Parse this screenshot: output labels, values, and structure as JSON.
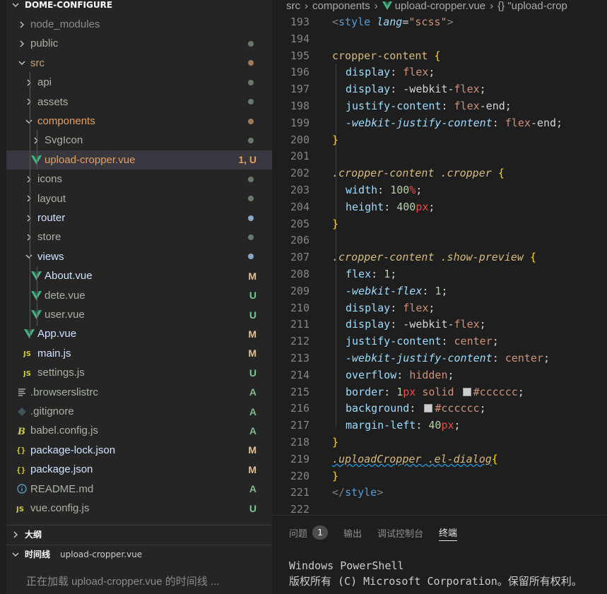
{
  "explorer": {
    "title": "DOME-CONFIGURE",
    "items": [
      {
        "label": "node_modules",
        "color": "#8c8c8c",
        "dec": "",
        "dot": ""
      },
      {
        "label": "public",
        "color": "#aab2a3",
        "dec": "",
        "dot": "#6a7a6a"
      },
      {
        "label": "src",
        "color": "#c5a27d",
        "dec": "",
        "dot": "#a07a5a"
      },
      {
        "label": "api",
        "color": "#aab2a3",
        "dec": "",
        "dot": "#6a7a6a"
      },
      {
        "label": "assets",
        "color": "#aab2a3",
        "dec": "",
        "dot": "#6a7a6a"
      },
      {
        "label": "components",
        "color": "#e2a062",
        "dec": "",
        "dot": "#a07a5a"
      },
      {
        "label": "SvgIcon",
        "color": "#aab2a3",
        "dec": "",
        "dot": "#6a7a6a"
      },
      {
        "label": "upload-cropper.vue",
        "color": "#e2a062",
        "dec": "1, U",
        "dot": ""
      },
      {
        "label": "icons",
        "color": "#aab2a3",
        "dec": "",
        "dot": "#6a7a6a"
      },
      {
        "label": "layout",
        "color": "#aab2a3",
        "dec": "",
        "dot": "#6a7a6a"
      },
      {
        "label": "router",
        "color": "#cfe3ff",
        "dec": "",
        "dot": "#88a7c7"
      },
      {
        "label": "store",
        "color": "#aab2a3",
        "dec": "",
        "dot": "#6a7a6a"
      },
      {
        "label": "views",
        "color": "#cfe3ff",
        "dec": "",
        "dot": "#88a7c7"
      },
      {
        "label": "About.vue",
        "color": "#cfe3ff",
        "dec": "M",
        "dot": ""
      },
      {
        "label": "dete.vue",
        "color": "#aab2a3",
        "dec": "U",
        "dot": ""
      },
      {
        "label": "user.vue",
        "color": "#aab2a3",
        "dec": "U",
        "dot": ""
      },
      {
        "label": "App.vue",
        "color": "#cfe3ff",
        "dec": "M",
        "dot": ""
      },
      {
        "label": "main.js",
        "color": "#cfe3ff",
        "dec": "M",
        "dot": ""
      },
      {
        "label": "settings.js",
        "color": "#aab2a3",
        "dec": "U",
        "dot": ""
      },
      {
        "label": ".browserslistrc",
        "color": "#aab2a3",
        "dec": "A",
        "dot": ""
      },
      {
        "label": ".gitignore",
        "color": "#aab2a3",
        "dec": "A",
        "dot": ""
      },
      {
        "label": "babel.config.js",
        "color": "#aab2a3",
        "dec": "A",
        "dot": ""
      },
      {
        "label": "package-lock.json",
        "color": "#cfe3ff",
        "dec": "M",
        "dot": ""
      },
      {
        "label": "package.json",
        "color": "#cfe3ff",
        "dec": "M",
        "dot": ""
      },
      {
        "label": "README.md",
        "color": "#aab2a3",
        "dec": "A",
        "dot": ""
      },
      {
        "label": "vue.config.js",
        "color": "#aab2a3",
        "dec": "U",
        "dot": ""
      }
    ],
    "outline_title": "大纲",
    "timeline_title": "时间线",
    "timeline_file": "upload-cropper.vue",
    "timeline_status": "正在加载 upload-cropper.vue 的时间线 ..."
  },
  "breadcrumb": {
    "parts": [
      "src",
      "components",
      "upload-cropper.vue",
      "{} \"upload-crop"
    ]
  },
  "editor": {
    "lines": [
      {
        "n": "193",
        "t": "<style lang=\"scss\">"
      },
      {
        "n": "194",
        "t": ""
      },
      {
        "n": "195",
        "t": "cropper-content {"
      },
      {
        "n": "196",
        "t": "display: flex;"
      },
      {
        "n": "197",
        "t": "display: -webkit-flex;"
      },
      {
        "n": "198",
        "t": "justify-content: flex-end;"
      },
      {
        "n": "199",
        "t": "-webkit-justify-content: flex-end;"
      },
      {
        "n": "200",
        "t": "}"
      },
      {
        "n": "201",
        "t": ""
      },
      {
        "n": "202",
        "t": ".cropper-content .cropper {"
      },
      {
        "n": "203",
        "t": "width: 100%;"
      },
      {
        "n": "204",
        "t": "height: 400px;"
      },
      {
        "n": "205",
        "t": "}"
      },
      {
        "n": "206",
        "t": ""
      },
      {
        "n": "207",
        "t": ".cropper-content .show-preview {"
      },
      {
        "n": "208",
        "t": "flex: 1;"
      },
      {
        "n": "209",
        "t": "-webkit-flex: 1;"
      },
      {
        "n": "210",
        "t": "display: flex;"
      },
      {
        "n": "211",
        "t": "display: -webkit-flex;"
      },
      {
        "n": "212",
        "t": "justify-content: center;"
      },
      {
        "n": "213",
        "t": "-webkit-justify-content: center;"
      },
      {
        "n": "214",
        "t": "overflow: hidden;"
      },
      {
        "n": "215",
        "t": "border: 1px solid #cccccc;"
      },
      {
        "n": "216",
        "t": "background: #cccccc;"
      },
      {
        "n": "217",
        "t": "margin-left: 40px;"
      },
      {
        "n": "218",
        "t": "}"
      },
      {
        "n": "219",
        "t": ".uploadCropper .el-dialog{"
      },
      {
        "n": "220",
        "t": "}"
      },
      {
        "n": "221",
        "t": "</style>"
      },
      {
        "n": "222",
        "t": ""
      }
    ]
  },
  "panel": {
    "tabs": [
      "问题",
      "输出",
      "调试控制台",
      "终端"
    ],
    "problems_count": "1",
    "terminal_lines": [
      "Windows PowerShell",
      "版权所有 (C) Microsoft Corporation。保留所有权利。"
    ]
  }
}
